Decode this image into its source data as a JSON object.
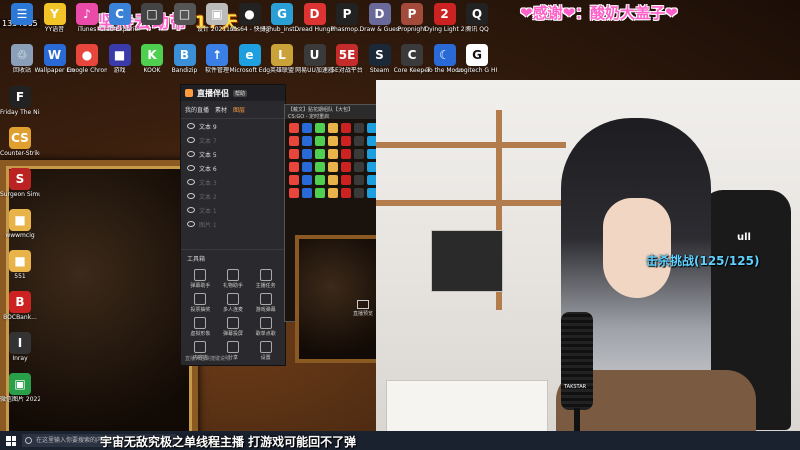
{
  "desktop": {
    "counter": "1334865",
    "icons": [
      {
        "label": "",
        "color": "#2b78d6",
        "glyph": "☰"
      },
      {
        "label": "YY语音",
        "color": "#f3c428",
        "glyph": "Y"
      },
      {
        "label": "iTunes",
        "color": "#ea4aa8",
        "glyph": "♪"
      },
      {
        "label": "Crab Experience",
        "color": "#3a82d8",
        "glyph": "C"
      },
      {
        "label": "",
        "color": "#444",
        "glyph": "□"
      },
      {
        "label": "",
        "color": "#555",
        "glyph": "□"
      },
      {
        "label": "设计 2021111...",
        "color": "#bbb",
        "glyph": "▣"
      },
      {
        "label": "obs64 - 快捷方式",
        "color": "#222",
        "glyph": "●"
      },
      {
        "label": "lghub_inst...",
        "color": "#2a9fd6",
        "glyph": "G"
      },
      {
        "label": "Dread Hunger",
        "color": "#d33",
        "glyph": "D"
      },
      {
        "label": "Phasmop...",
        "color": "#222",
        "glyph": "P"
      },
      {
        "label": "Draw & Guess",
        "color": "#6a6a9a",
        "glyph": "D"
      },
      {
        "label": "Propnight",
        "color": "#a34a3a",
        "glyph": "P"
      },
      {
        "label": "Dying Light 2",
        "color": "#c22",
        "glyph": "2"
      },
      {
        "label": "腾讯 QQ",
        "color": "#222",
        "glyph": "Q"
      }
    ],
    "icons_row2": [
      {
        "label": "回收站",
        "color": "#8aa0b8",
        "glyph": "♲"
      },
      {
        "label": "Wallpaper Engine",
        "color": "#2a6ad6",
        "glyph": "W"
      },
      {
        "label": "Google Chrome",
        "color": "#e8453c",
        "glyph": "●"
      },
      {
        "label": "游戏",
        "color": "#3a3aaa",
        "glyph": "■"
      },
      {
        "label": "KOOK",
        "color": "#4fcf4f",
        "glyph": "K"
      },
      {
        "label": "Bandizip",
        "color": "#3a8fd6",
        "glyph": "B"
      },
      {
        "label": "软件管理",
        "color": "#3a7fe6",
        "glyph": "↑"
      },
      {
        "label": "Microsoft Edge",
        "color": "#1e9fe0",
        "glyph": "e"
      },
      {
        "label": "英雄联盟",
        "color": "#c9a23a",
        "glyph": "L"
      },
      {
        "label": "网易UU加速器",
        "color": "#3a3a3a",
        "glyph": "U"
      },
      {
        "label": "5E对战平台",
        "color": "#c42b2b",
        "glyph": "5E"
      },
      {
        "label": "Steam",
        "color": "#1b2838",
        "glyph": "S"
      },
      {
        "label": "Core Keeper",
        "color": "#3a3a3a",
        "glyph": "C"
      },
      {
        "label": "To the Moon",
        "color": "#2a6ad6",
        "glyph": "☾"
      },
      {
        "label": "Logitech G HUB",
        "color": "#fff",
        "glyph": "G"
      }
    ],
    "left_column": [
      {
        "label": "Friday The Nine Sour...",
        "color": "#222",
        "glyph": "F"
      },
      {
        "label": "Counter-Strike: Global Off...",
        "color": "#e0a030",
        "glyph": "CS"
      },
      {
        "label": "Surgeon Simulator 2",
        "color": "#b22",
        "glyph": "S"
      },
      {
        "label": "wwwmcig",
        "color": "#e8b44a",
        "glyph": "■"
      },
      {
        "label": "551",
        "color": "#e8b44a",
        "glyph": "■"
      },
      {
        "label": "BOCBank...",
        "color": "#c22",
        "glyph": "B"
      },
      {
        "label": "Inray",
        "color": "#333",
        "glyph": "I"
      },
      {
        "label": "微信图片 2022051...",
        "color": "#2a9f4a",
        "glyph": "▣"
      }
    ],
    "banner_main": "坚持云动带",
    "banner_days": "17天",
    "thanks": "❤感谢❤：酸奶大盖子❤"
  },
  "app": {
    "title": "直播伴侣",
    "version": "帮助",
    "tabs": [
      "我的直播",
      "素材",
      "图层"
    ],
    "active_tab": 2,
    "layers": [
      {
        "label": "文本 9",
        "dim": false
      },
      {
        "label": "文本 7",
        "dim": true
      },
      {
        "label": "文本 5",
        "dim": false
      },
      {
        "label": "文本 6",
        "dim": false
      },
      {
        "label": "文本 3",
        "dim": true
      },
      {
        "label": "文本 2",
        "dim": true
      },
      {
        "label": "文本 1",
        "dim": true
      },
      {
        "label": "图片 1",
        "dim": true
      }
    ],
    "tools_title": "工具箱",
    "tools": [
      "弹幕助手",
      "礼物助手",
      "主播任务",
      "投票抽奖",
      "多人连麦",
      "游戏弹幕",
      "虚拟形象",
      "弹幕投屏",
      "歌单点歌",
      "内容店",
      "分享",
      "设置"
    ],
    "footer": "直播伴侣快捷键说明"
  },
  "mirror": {
    "title": "【戴文】贴花期组队【大包】",
    "subtitle": "CS:GO - 定时重启",
    "preview_label": "直播预览"
  },
  "overlay": {
    "challenge": "击杀挑战(125/125)",
    "ticker": "宇宙无敌究极之单线程主播 打游戏可能回不了弹",
    "mic_label": "TAKSTAR",
    "chair_brand": "ull"
  },
  "taskbar": {
    "search_placeholder": "在这里输入你要搜索的内容"
  },
  "colors": {
    "accent": "#ff5fc8",
    "challenge": "#5fd0ff",
    "app_active_tab": "#ff9b3d"
  }
}
